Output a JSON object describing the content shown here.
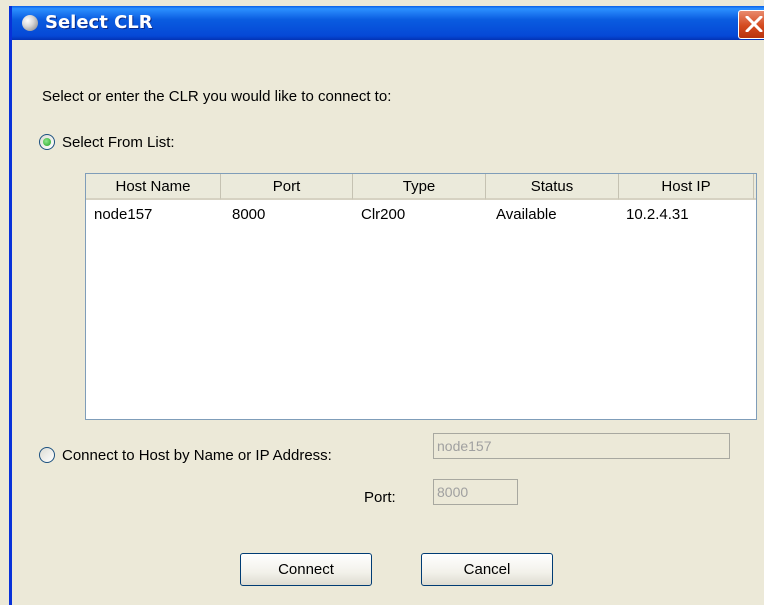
{
  "window": {
    "title": "Select CLR"
  },
  "prompt": "Select or enter the CLR you would like to connect to:",
  "options": {
    "select_from_list": {
      "label": "Select From List:",
      "checked": true
    },
    "connect_by_host": {
      "label": "Connect to Host by Name or IP Address:",
      "checked": false
    }
  },
  "table": {
    "columns": [
      "Host Name",
      "Port",
      "Type",
      "Status",
      "Host IP"
    ],
    "rows": [
      [
        "node157",
        "8000",
        "Clr200",
        "Available",
        "10.2.4.31"
      ]
    ]
  },
  "host_field": {
    "value": "node157"
  },
  "port_field": {
    "label": "Port:",
    "value": "8000"
  },
  "buttons": {
    "connect": "Connect",
    "cancel": "Cancel"
  },
  "colors": {
    "titlebar": "#0a5ce0",
    "dialog_bg": "#ece9d8",
    "close_button": "#d44a1f",
    "radio_checked": "#21a121"
  }
}
